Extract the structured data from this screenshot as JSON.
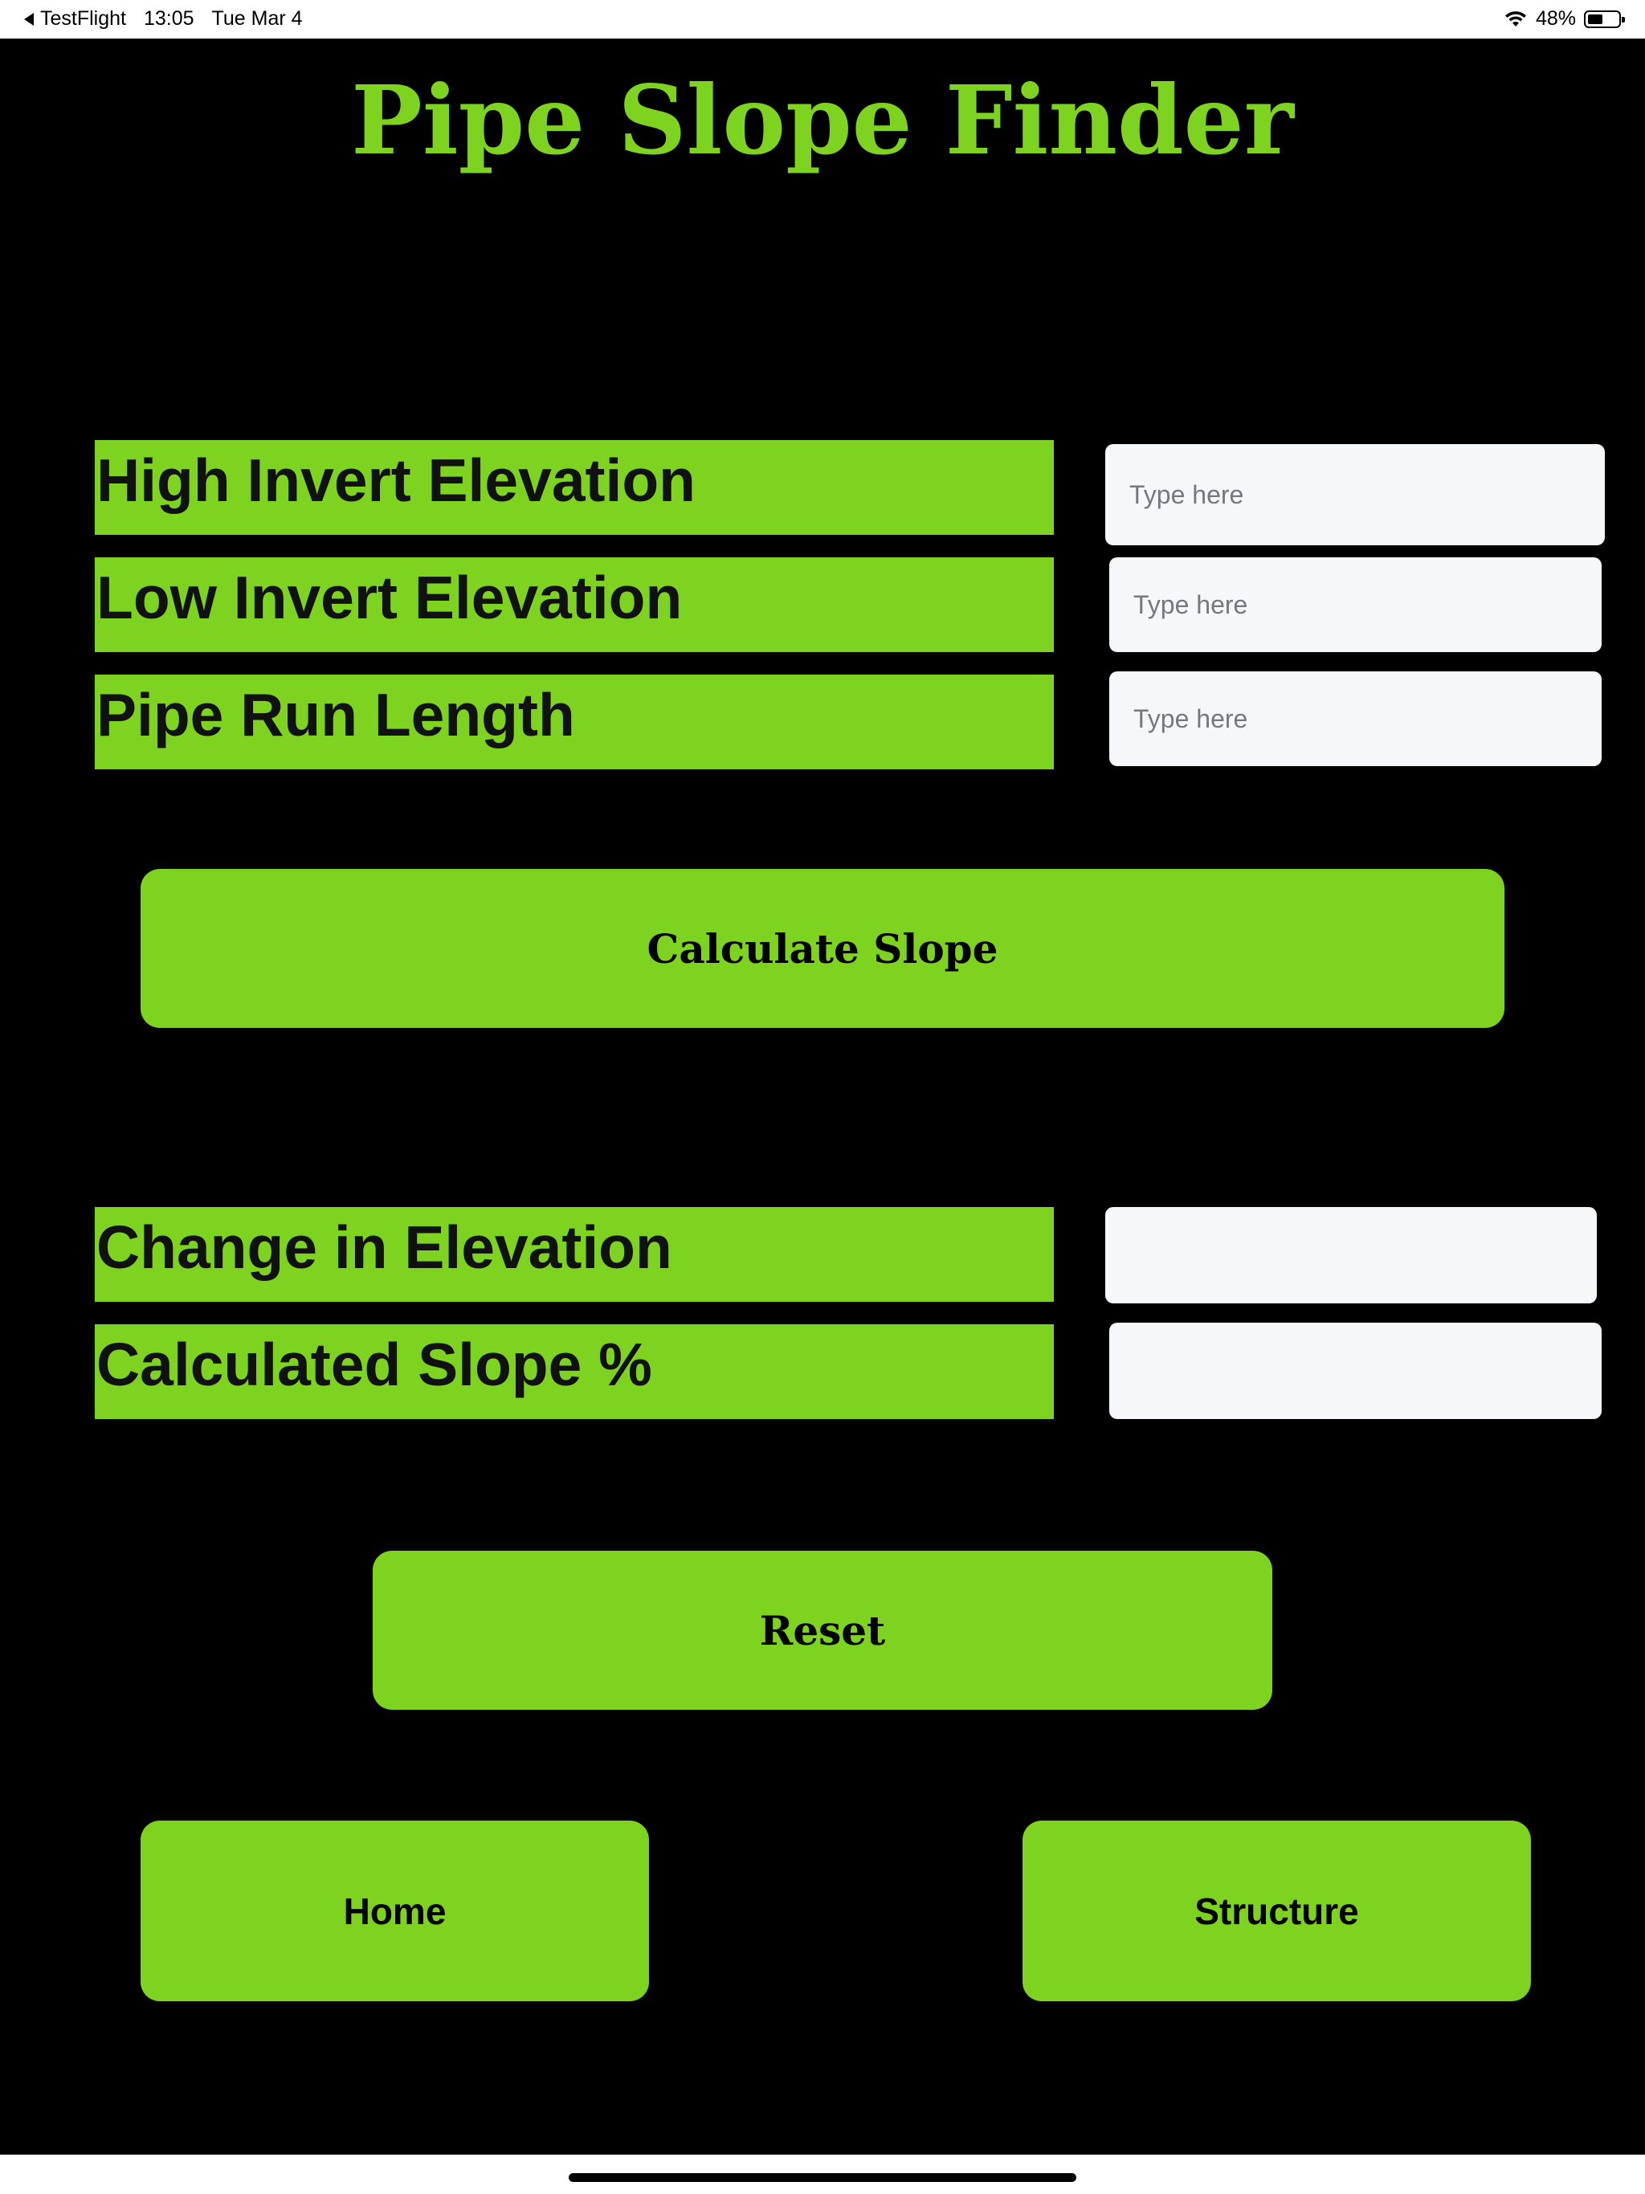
{
  "status_bar": {
    "back_app": "TestFlight",
    "time": "13:05",
    "date": "Tue Mar 4",
    "battery": "48%",
    "battery_level": 0.48
  },
  "title": "Pipe Slope Finder",
  "inputs": {
    "high_invert_label": "High Invert Elevation",
    "high_invert_placeholder": "Type here",
    "high_invert_value": "",
    "low_invert_label": "Low Invert Elevation",
    "low_invert_placeholder": "Type here",
    "low_invert_value": "",
    "run_length_label": "Pipe Run Length",
    "run_length_placeholder": "Type here",
    "run_length_value": ""
  },
  "calculate_label": "Calculate Slope",
  "results": {
    "change_label": "Change in Elevation",
    "change_value": "",
    "slope_label": "Calculated Slope %",
    "slope_value": ""
  },
  "reset_label": "Reset",
  "nav": {
    "home_label": "Home",
    "structure_label": "Structure"
  },
  "colors": {
    "accent": "#7ed321",
    "background": "#000000",
    "field": "#f6f7f9"
  }
}
